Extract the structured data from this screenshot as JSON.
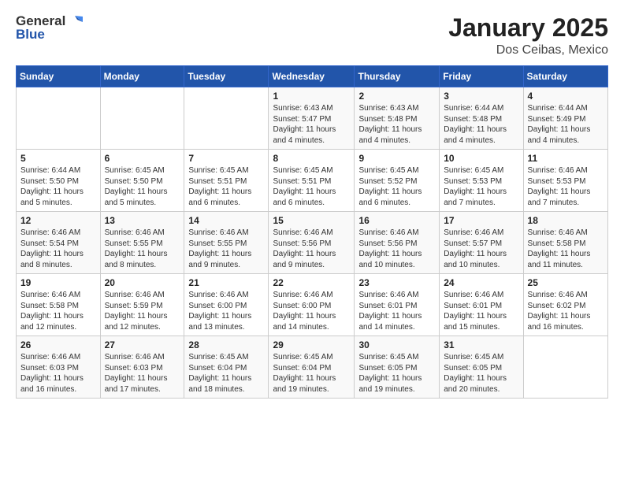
{
  "header": {
    "logo_general": "General",
    "logo_blue": "Blue",
    "month": "January 2025",
    "location": "Dos Ceibas, Mexico"
  },
  "days_of_week": [
    "Sunday",
    "Monday",
    "Tuesday",
    "Wednesday",
    "Thursday",
    "Friday",
    "Saturday"
  ],
  "weeks": [
    [
      {
        "day": "",
        "info": ""
      },
      {
        "day": "",
        "info": ""
      },
      {
        "day": "",
        "info": ""
      },
      {
        "day": "1",
        "info": "Sunrise: 6:43 AM\nSunset: 5:47 PM\nDaylight: 11 hours and 4 minutes."
      },
      {
        "day": "2",
        "info": "Sunrise: 6:43 AM\nSunset: 5:48 PM\nDaylight: 11 hours and 4 minutes."
      },
      {
        "day": "3",
        "info": "Sunrise: 6:44 AM\nSunset: 5:48 PM\nDaylight: 11 hours and 4 minutes."
      },
      {
        "day": "4",
        "info": "Sunrise: 6:44 AM\nSunset: 5:49 PM\nDaylight: 11 hours and 4 minutes."
      }
    ],
    [
      {
        "day": "5",
        "info": "Sunrise: 6:44 AM\nSunset: 5:50 PM\nDaylight: 11 hours and 5 minutes."
      },
      {
        "day": "6",
        "info": "Sunrise: 6:45 AM\nSunset: 5:50 PM\nDaylight: 11 hours and 5 minutes."
      },
      {
        "day": "7",
        "info": "Sunrise: 6:45 AM\nSunset: 5:51 PM\nDaylight: 11 hours and 6 minutes."
      },
      {
        "day": "8",
        "info": "Sunrise: 6:45 AM\nSunset: 5:51 PM\nDaylight: 11 hours and 6 minutes."
      },
      {
        "day": "9",
        "info": "Sunrise: 6:45 AM\nSunset: 5:52 PM\nDaylight: 11 hours and 6 minutes."
      },
      {
        "day": "10",
        "info": "Sunrise: 6:45 AM\nSunset: 5:53 PM\nDaylight: 11 hours and 7 minutes."
      },
      {
        "day": "11",
        "info": "Sunrise: 6:46 AM\nSunset: 5:53 PM\nDaylight: 11 hours and 7 minutes."
      }
    ],
    [
      {
        "day": "12",
        "info": "Sunrise: 6:46 AM\nSunset: 5:54 PM\nDaylight: 11 hours and 8 minutes."
      },
      {
        "day": "13",
        "info": "Sunrise: 6:46 AM\nSunset: 5:55 PM\nDaylight: 11 hours and 8 minutes."
      },
      {
        "day": "14",
        "info": "Sunrise: 6:46 AM\nSunset: 5:55 PM\nDaylight: 11 hours and 9 minutes."
      },
      {
        "day": "15",
        "info": "Sunrise: 6:46 AM\nSunset: 5:56 PM\nDaylight: 11 hours and 9 minutes."
      },
      {
        "day": "16",
        "info": "Sunrise: 6:46 AM\nSunset: 5:56 PM\nDaylight: 11 hours and 10 minutes."
      },
      {
        "day": "17",
        "info": "Sunrise: 6:46 AM\nSunset: 5:57 PM\nDaylight: 11 hours and 10 minutes."
      },
      {
        "day": "18",
        "info": "Sunrise: 6:46 AM\nSunset: 5:58 PM\nDaylight: 11 hours and 11 minutes."
      }
    ],
    [
      {
        "day": "19",
        "info": "Sunrise: 6:46 AM\nSunset: 5:58 PM\nDaylight: 11 hours and 12 minutes."
      },
      {
        "day": "20",
        "info": "Sunrise: 6:46 AM\nSunset: 5:59 PM\nDaylight: 11 hours and 12 minutes."
      },
      {
        "day": "21",
        "info": "Sunrise: 6:46 AM\nSunset: 6:00 PM\nDaylight: 11 hours and 13 minutes."
      },
      {
        "day": "22",
        "info": "Sunrise: 6:46 AM\nSunset: 6:00 PM\nDaylight: 11 hours and 14 minutes."
      },
      {
        "day": "23",
        "info": "Sunrise: 6:46 AM\nSunset: 6:01 PM\nDaylight: 11 hours and 14 minutes."
      },
      {
        "day": "24",
        "info": "Sunrise: 6:46 AM\nSunset: 6:01 PM\nDaylight: 11 hours and 15 minutes."
      },
      {
        "day": "25",
        "info": "Sunrise: 6:46 AM\nSunset: 6:02 PM\nDaylight: 11 hours and 16 minutes."
      }
    ],
    [
      {
        "day": "26",
        "info": "Sunrise: 6:46 AM\nSunset: 6:03 PM\nDaylight: 11 hours and 16 minutes."
      },
      {
        "day": "27",
        "info": "Sunrise: 6:46 AM\nSunset: 6:03 PM\nDaylight: 11 hours and 17 minutes."
      },
      {
        "day": "28",
        "info": "Sunrise: 6:45 AM\nSunset: 6:04 PM\nDaylight: 11 hours and 18 minutes."
      },
      {
        "day": "29",
        "info": "Sunrise: 6:45 AM\nSunset: 6:04 PM\nDaylight: 11 hours and 19 minutes."
      },
      {
        "day": "30",
        "info": "Sunrise: 6:45 AM\nSunset: 6:05 PM\nDaylight: 11 hours and 19 minutes."
      },
      {
        "day": "31",
        "info": "Sunrise: 6:45 AM\nSunset: 6:05 PM\nDaylight: 11 hours and 20 minutes."
      },
      {
        "day": "",
        "info": ""
      }
    ]
  ]
}
